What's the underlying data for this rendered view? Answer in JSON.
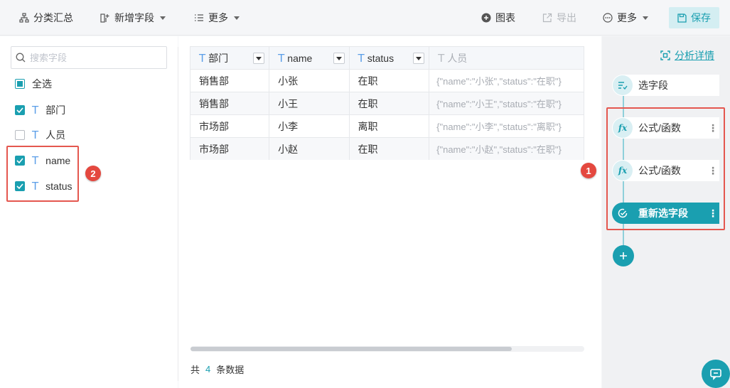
{
  "toolbar": {
    "group_summary": "分类汇总",
    "add_field": "新增字段",
    "more_left": "更多",
    "chart": "图表",
    "export": "导出",
    "more_right": "更多",
    "save": "保存"
  },
  "left_panel": {
    "search_placeholder": "搜索字段",
    "select_all": "全选",
    "fields": [
      {
        "name": "部门",
        "checked": true
      },
      {
        "name": "人员",
        "checked": false
      },
      {
        "name": "name",
        "checked": true
      },
      {
        "name": "status",
        "checked": true
      }
    ],
    "badge": "2"
  },
  "grid": {
    "columns": [
      "部门",
      "name",
      "status",
      "人员"
    ],
    "rows": [
      [
        "销售部",
        "小张",
        "在职",
        "{\"name\":\"小张\",\"status\":\"在职\"}"
      ],
      [
        "销售部",
        "小王",
        "在职",
        "{\"name\":\"小王\",\"status\":\"在职\"}"
      ],
      [
        "市场部",
        "小李",
        "离职",
        "{\"name\":\"小李\",\"status\":\"离职\"}"
      ],
      [
        "市场部",
        "小赵",
        "在职",
        "{\"name\":\"小赵\",\"status\":\"在职\"}"
      ]
    ],
    "footer_prefix": "共",
    "footer_count": "4",
    "footer_suffix": "条数据"
  },
  "right_panel": {
    "analysis_link": "分析详情",
    "steps": [
      {
        "label": "选字段",
        "icon": "select-field-icon"
      },
      {
        "label": "公式/函数",
        "icon": "fx-icon"
      },
      {
        "label": "公式/函数",
        "icon": "fx-icon"
      },
      {
        "label": "重新选字段",
        "icon": "check-circle-icon"
      }
    ],
    "badge": "1",
    "fx_glyph": "fx"
  },
  "colors": {
    "accent": "#1a9fb0",
    "annotation": "#e4574f",
    "type_icon": "#5b9ee8"
  }
}
